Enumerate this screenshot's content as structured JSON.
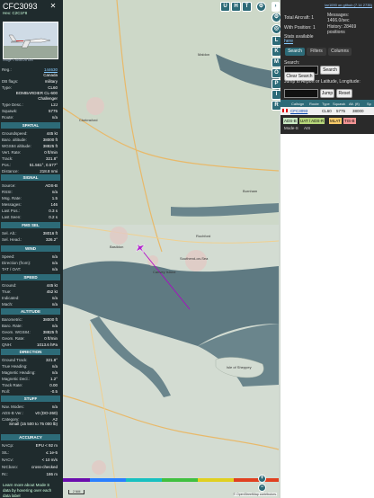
{
  "aircraft": {
    "callsign": "CFC3093",
    "hex_line": "Hex: C2C1F8",
    "photo_caption": "Image © ABA128 DIA",
    "close_glyph": "✕"
  },
  "details": {
    "reg_label": "Reg.:",
    "reg_value": "144630",
    "country": "Canada",
    "db_flags_label": "DB flags:",
    "db_flags_value": "military",
    "type_label": "Type:",
    "type_value": "CL60",
    "type_desc": "BOMBARDIER CL-600",
    "type_desc2": "Challenger",
    "type_desc_label": "Type Desc.:",
    "type_desc_value": "L2J",
    "squawk_label": "Squawk:",
    "squawk_value": "5775",
    "route_label": "Route:",
    "route_value": "n/a"
  },
  "sections": {
    "spatial": "SPATIAL",
    "signal": "SIGNAL",
    "fms_sel": "FMS SEL",
    "wind": "WIND",
    "speed": "SPEED",
    "altitude": "ALTITUDE",
    "direction": "DIRECTION",
    "stuff": "STUFF",
    "accuracy": "ACCURACY"
  },
  "spatial": [
    {
      "k": "Groundspeed:",
      "v": "445 kt"
    },
    {
      "k": "Baro. altitude:",
      "v": "38000 ft"
    },
    {
      "k": "WGS84 altitude:",
      "v": "38825 ft"
    },
    {
      "k": "Vert. Rate:",
      "v": "0 ft/min"
    },
    {
      "k": "Track:",
      "v": "321.8°"
    },
    {
      "k": "Pos.:",
      "v": "51.561°, 0.577°"
    },
    {
      "k": "Distance:",
      "v": "218.8 nmi"
    }
  ],
  "signal": [
    {
      "k": "Source:",
      "v": "ADS-B"
    },
    {
      "k": "RSSI:",
      "v": "n/a"
    },
    {
      "k": "Msg. Rate:",
      "v": "1.5"
    },
    {
      "k": "Messages:",
      "v": "146"
    },
    {
      "k": "Last Pos.:",
      "v": "0.3 s"
    },
    {
      "k": "Last Seen:",
      "v": "0.2 s"
    }
  ],
  "fms": [
    {
      "k": "Sel. Alt.:",
      "v": "38016 ft"
    },
    {
      "k": "Sel. Head.:",
      "v": "326.2°"
    }
  ],
  "wind": [
    {
      "k": "Speed:",
      "v": "n/a"
    },
    {
      "k": "Direction (from):",
      "v": "n/a"
    },
    {
      "k": "TAT / OAT:",
      "v": "n/a"
    }
  ],
  "speed": [
    {
      "k": "Ground:",
      "v": "445 kt"
    },
    {
      "k": "True:",
      "v": "452 kt"
    },
    {
      "k": "Indicated:",
      "v": "n/a"
    },
    {
      "k": "Mach:",
      "v": "n/a"
    }
  ],
  "altitude": [
    {
      "k": "Barometric:",
      "v": "38000 ft"
    },
    {
      "k": "Baro. Rate:",
      "v": "n/a"
    },
    {
      "k": "Geom. WGS84:",
      "v": "38825 ft"
    },
    {
      "k": "Geom. Rate:",
      "v": "0 ft/min"
    },
    {
      "k": "QNH:",
      "v": "1013.6 hPa"
    }
  ],
  "direction": [
    {
      "k": "Ground Track:",
      "v": "321.8°"
    },
    {
      "k": "True Heading:",
      "v": "n/a"
    },
    {
      "k": "Magnetic Heading:",
      "v": "n/a"
    },
    {
      "k": "Magnetic Decl.:",
      "v": "1.2°"
    },
    {
      "k": "Track Rate:",
      "v": "0.00"
    },
    {
      "k": "Roll:",
      "v": "-0.5"
    }
  ],
  "stuff": [
    {
      "k": "Nav. Modes:",
      "v": "n/a"
    },
    {
      "k": "ADS-B Ver.:",
      "v": "v0 (DO-260)"
    },
    {
      "k": "Category:",
      "v": "A2"
    }
  ],
  "stuff_note": "Small (15 500 to 75 000 lb)",
  "accuracy": [
    {
      "k": "NACp:",
      "v": "EPU < 92 m"
    },
    {
      "k": "SIL:",
      "v": "≤ 1e-5"
    },
    {
      "k": "NACv:",
      "v": "< 10 m/s"
    },
    {
      "k": "NICbaro:",
      "v": "cross-checked"
    },
    {
      "k": "Rc:",
      "v": "186 m"
    }
  ],
  "footer_text": "Learn more about Mode S data by hovering over each data label",
  "map": {
    "top_buttons": [
      "U",
      "H",
      "T"
    ],
    "side_buttons": [
      "L",
      "K",
      "M",
      "O",
      "P",
      "I",
      "R"
    ],
    "zoom_in": "+",
    "zoom_out": "−",
    "scale": "2 NM",
    "attribution": "© OpenStreetMap contributors.",
    "places": [
      "Chelmsford",
      "Basildon",
      "Southend-on-Sea",
      "Canvey Island",
      "Isle of Sheppey",
      "Rochford",
      "Maldon",
      "Burnham"
    ]
  },
  "panel": {
    "github_link": "tar1090 on github (7.14 2735)",
    "total_aircraft": "Total Aircraft: 1",
    "messages": "Messages:",
    "messages_value": "1466.0/sec",
    "with_position": "With Position: 1",
    "history": "History: 28469 positions",
    "stats": "Stats available",
    "stats_link": "here",
    "tabs": [
      "Search",
      "Filters",
      "Columns"
    ],
    "search_label": "Search:",
    "search_button": "Search",
    "clear_search": "Clear Search",
    "jump_label": "Jump to Airport or Latitude, Longitude:",
    "jump_button": "Jump",
    "reset_button": "Reset",
    "table_headers": [
      "Callsign",
      "Route",
      "Type",
      "Squawk",
      "Alt. (ft)",
      "Sp"
    ],
    "table_row": {
      "callsign": "CFC3093",
      "type": "CL60",
      "squawk": "5775",
      "alt": "38000"
    },
    "badges": [
      "ADS-B",
      "UAT / ADS-R",
      "MLAT",
      "TIS-B"
    ],
    "badges2": [
      "Mode-S",
      "AIS"
    ]
  },
  "colors": {
    "panel_bg": "#1f2b2d",
    "section_bg": "#2d6b78",
    "aircraft": "#b022cc",
    "trail": "#b000c8",
    "water": "#5f7a82"
  }
}
